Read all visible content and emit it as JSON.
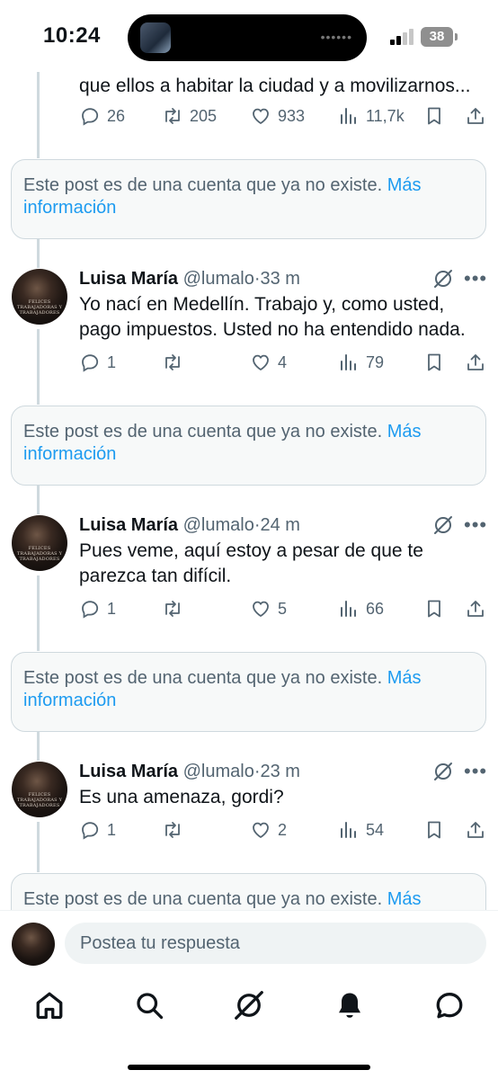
{
  "status_bar": {
    "time": "10:24",
    "battery": "38"
  },
  "top_post": {
    "text": "que ellos a habitar la ciudad y a movilizarnos...",
    "replies": "26",
    "reposts": "205",
    "likes": "933",
    "views": "11,7k"
  },
  "notice": {
    "text": "Este post es de una cuenta que ya no existe.",
    "link": "Más información",
    "link_line1": "Más",
    "link_line2": "información"
  },
  "avatar_text": [
    "FELICES",
    "TRABAJADORAS Y",
    "TRABAJADORES"
  ],
  "posts": [
    {
      "name": "Luisa María",
      "handle": "@lumalo",
      "sep": "·",
      "time": "33 m",
      "text_lines": [
        "Yo nací en Medellín. Trabajo y, como usted,",
        "pago impuestos. Usted no ha entendido nada."
      ],
      "replies": "1",
      "reposts": "",
      "likes": "4",
      "views": "79"
    },
    {
      "name": "Luisa María",
      "handle": "@lumalo",
      "sep": "·",
      "time": "24 m",
      "text_lines": [
        "Pues veme, aquí estoy a pesar de que te",
        "parezca tan difícil."
      ],
      "replies": "1",
      "reposts": "",
      "likes": "5",
      "views": "66"
    },
    {
      "name": "Luisa María",
      "handle": "@lumalo",
      "sep": "·",
      "time": "23 m",
      "text_lines": [
        "Es una amenaza, gordi?"
      ],
      "replies": "1",
      "reposts": "",
      "likes": "2",
      "views": "54"
    }
  ],
  "reply_bar": {
    "placeholder": "Postea tu respuesta"
  },
  "nav": [
    "home-icon",
    "search-icon",
    "grok-icon",
    "notifications-icon",
    "messages-icon"
  ],
  "colors": {
    "accent": "#1d9bf0",
    "secondary_text": "#536471",
    "border": "#cfd9de"
  }
}
